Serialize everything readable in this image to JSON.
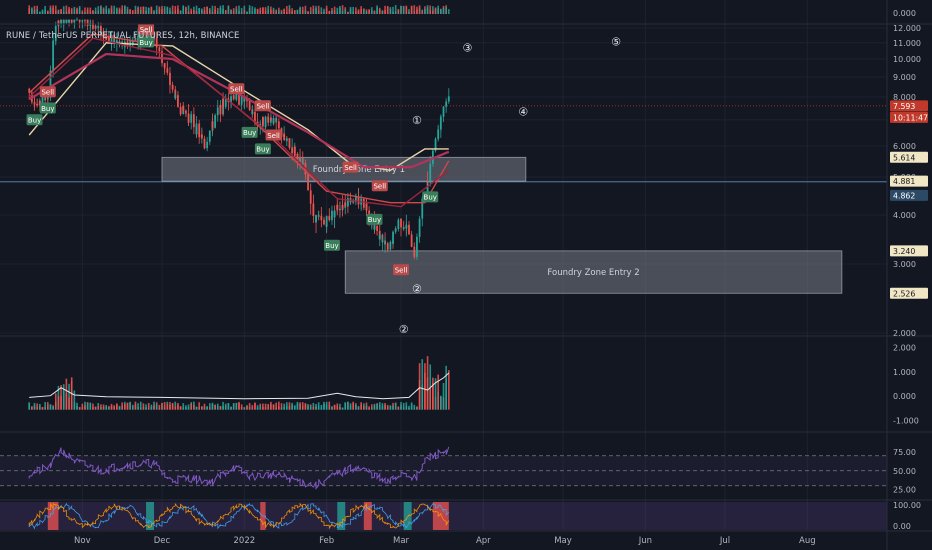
{
  "title": "RUNE / TetherUS PERPETUAL FUTURES, 12h, BINANCE",
  "chart_data": [
    {
      "type": "candlestick",
      "title": "RUNE / TetherUS PERPETUAL FUTURES, 12h, BINANCE",
      "ylim": [
        2.0,
        12.0
      ],
      "y_ticks": [
        "12.000",
        "11.000",
        "10.000",
        "9.000",
        "8.000",
        "7.000",
        "6.000",
        "5.000",
        "4.000",
        "3.000",
        "2.000"
      ],
      "x_ticks": [
        "Nov",
        "Dec",
        "2022",
        "Feb",
        "Mar",
        "Apr",
        "May",
        "Jun",
        "Jul",
        "Aug"
      ],
      "price_path": [
        [
          "2021-10-12",
          8.4
        ],
        [
          "2021-10-16",
          7.6
        ],
        [
          "2021-10-20",
          8.1
        ],
        [
          "2021-10-23",
          12.2
        ],
        [
          "2021-10-28",
          12.8
        ],
        [
          "2021-11-05",
          12.4
        ],
        [
          "2021-11-12",
          11.2
        ],
        [
          "2021-11-18",
          10.8
        ],
        [
          "2021-11-25",
          11.6
        ],
        [
          "2021-11-29",
          11.2
        ],
        [
          "2021-12-04",
          9.0
        ],
        [
          "2021-12-08",
          7.6
        ],
        [
          "2021-12-13",
          7.0
        ],
        [
          "2021-12-18",
          6.0
        ],
        [
          "2021-12-23",
          7.4
        ],
        [
          "2021-12-28",
          8.1
        ],
        [
          "2022-01-02",
          7.8
        ],
        [
          "2022-01-07",
          6.8
        ],
        [
          "2022-01-12",
          7.1
        ],
        [
          "2022-01-17",
          6.2
        ],
        [
          "2022-01-20",
          5.9
        ],
        [
          "2022-01-24",
          5.3
        ],
        [
          "2022-01-28",
          4.0
        ],
        [
          "2022-02-01",
          3.8
        ],
        [
          "2022-02-06",
          4.2
        ],
        [
          "2022-02-11",
          4.4
        ],
        [
          "2022-02-16",
          4.3
        ],
        [
          "2022-02-21",
          3.6
        ],
        [
          "2022-02-25",
          3.2
        ],
        [
          "2022-03-01",
          3.9
        ],
        [
          "2022-03-04",
          3.7
        ],
        [
          "2022-03-07",
          3.2
        ],
        [
          "2022-03-10",
          4.3
        ],
        [
          "2022-03-12",
          4.9
        ],
        [
          "2022-03-14",
          5.9
        ],
        [
          "2022-03-16",
          6.8
        ],
        [
          "2022-03-18",
          7.6
        ],
        [
          "2022-03-19",
          7.9
        ]
      ],
      "moving_averages": [
        {
          "color": "#e8d6a8",
          "values": [
            [
              "2021-10-12",
              6.4
            ],
            [
              "2021-11-10",
              11.0
            ],
            [
              "2021-12-05",
              10.8
            ],
            [
              "2022-01-01",
              8.3
            ],
            [
              "2022-01-25",
              6.6
            ],
            [
              "2022-02-10",
              5.4
            ],
            [
              "2022-02-25",
              5.2
            ],
            [
              "2022-03-10",
              5.9
            ],
            [
              "2022-03-19",
              5.9
            ]
          ]
        },
        {
          "color": "#b0345a",
          "values": [
            [
              "2021-10-12",
              7.9
            ],
            [
              "2021-11-10",
              10.3
            ],
            [
              "2021-12-05",
              10.0
            ],
            [
              "2022-01-01",
              8.0
            ],
            [
              "2022-01-25",
              6.5
            ],
            [
              "2022-02-15",
              5.3
            ],
            [
              "2022-03-05",
              5.3
            ],
            [
              "2022-03-19",
              5.8
            ]
          ]
        },
        {
          "color": "#d04848",
          "values": [
            [
              "2021-10-12",
              8.2
            ],
            [
              "2021-11-05",
              11.6
            ],
            [
              "2021-12-01",
              10.8
            ],
            [
              "2022-01-05",
              6.9
            ],
            [
              "2022-02-01",
              4.6
            ],
            [
              "2022-02-25",
              4.3
            ],
            [
              "2022-03-10",
              4.3
            ],
            [
              "2022-03-19",
              5.5
            ]
          ]
        },
        {
          "color": "#9c2540",
          "values": [
            [
              "2021-10-12",
              8.0
            ],
            [
              "2021-11-05",
              11.3
            ],
            [
              "2021-12-05",
              10.2
            ],
            [
              "2022-01-10",
              6.5
            ],
            [
              "2022-02-05",
              4.4
            ],
            [
              "2022-03-01",
              4.2
            ],
            [
              "2022-03-19",
              5.2
            ]
          ]
        }
      ],
      "signals": [
        {
          "label": "Sell",
          "date": "2021-10-19",
          "price": 8.25,
          "kind": "sell"
        },
        {
          "label": "Buy",
          "date": "2021-10-19",
          "price": 7.5,
          "kind": "buy"
        },
        {
          "label": "Buy",
          "date": "2021-10-14",
          "price": 7.0,
          "kind": "buy"
        },
        {
          "label": "Sell",
          "date": "2021-11-25",
          "price": 11.9,
          "kind": "sell"
        },
        {
          "label": "Buy",
          "date": "2021-11-25",
          "price": 11.05,
          "kind": "buy"
        },
        {
          "label": "Sell",
          "date": "2021-12-29",
          "price": 8.4,
          "kind": "sell"
        },
        {
          "label": "Sell",
          "date": "2022-01-08",
          "price": 7.6,
          "kind": "sell"
        },
        {
          "label": "Buy",
          "date": "2022-01-03",
          "price": 6.5,
          "kind": "buy"
        },
        {
          "label": "Sell",
          "date": "2022-01-12",
          "price": 6.4,
          "kind": "sell"
        },
        {
          "label": "Buy",
          "date": "2022-01-08",
          "price": 5.9,
          "kind": "buy"
        },
        {
          "label": "Sell",
          "date": "2022-02-10",
          "price": 5.3,
          "kind": "sell"
        },
        {
          "label": "Sell",
          "date": "2022-02-21",
          "price": 4.75,
          "kind": "sell"
        },
        {
          "label": "Buy",
          "date": "2022-02-19",
          "price": 3.9,
          "kind": "buy"
        },
        {
          "label": "Buy",
          "date": "2022-02-03",
          "price": 3.35,
          "kind": "buy"
        },
        {
          "label": "Sell",
          "date": "2022-03-01",
          "price": 2.9,
          "kind": "sell"
        },
        {
          "label": "Buy",
          "date": "2022-03-12",
          "price": 4.45,
          "kind": "buy"
        }
      ],
      "zones": [
        {
          "label": "Foundry Zone Entry 1",
          "from": "2021-12-01",
          "to": "2022-04-17",
          "top": 5.614,
          "bottom": 4.881
        },
        {
          "label": "Foundry Zone Entry 2",
          "from": "2022-02-08",
          "to": "2022-08-14",
          "top": 3.24,
          "bottom": 2.526
        }
      ],
      "wave_labels": [
        {
          "label": "①",
          "date": "2022-03-07",
          "price": 7.0
        },
        {
          "label": "②",
          "date": "2022-03-02",
          "price": 2.05
        },
        {
          "label": "②",
          "date": "2022-03-07",
          "price": 2.6
        },
        {
          "label": "③",
          "date": "2022-03-26",
          "price": 10.7
        },
        {
          "label": "④",
          "date": "2022-04-16",
          "price": 7.35
        },
        {
          "label": "⑤",
          "date": "2022-05-21",
          "price": 11.1
        }
      ],
      "price_badges": [
        {
          "text": "7.593",
          "value": 7.593,
          "bg": "#c0392b",
          "fg": "#ffffff"
        },
        {
          "text": "10:11:47",
          "value": 7.1,
          "bg": "#c0392b",
          "fg": "#ffffff"
        },
        {
          "text": "5.614",
          "value": 5.614,
          "bg": "#f1e7c4",
          "fg": "#131722"
        },
        {
          "text": "4.881",
          "value": 4.881,
          "bg": "#f1e7c4",
          "fg": "#131722"
        },
        {
          "text": "4.862",
          "value": 4.49,
          "bg": "#2c4a66",
          "fg": "#ffffff"
        },
        {
          "text": "3.240",
          "value": 3.24,
          "bg": "#f1e7c4",
          "fg": "#131722"
        },
        {
          "text": "2.526",
          "value": 2.526,
          "bg": "#f1e7c4",
          "fg": "#131722"
        }
      ],
      "last_price": 7.593,
      "horizontal_line": 4.862
    },
    {
      "type": "bar",
      "title": "",
      "top_axis_label": "0.000",
      "y_ticks": [
        "2.000",
        "1.000",
        "0.000",
        "-1.000"
      ],
      "ylim": [
        -1.3,
        2.3
      ],
      "oscillator": [
        [
          "2021-10-12",
          -0.05
        ],
        [
          "2021-10-20",
          0.02
        ],
        [
          "2021-10-24",
          0.35
        ],
        [
          "2021-10-29",
          0.05
        ],
        [
          "2021-11-10",
          -0.02
        ],
        [
          "2021-12-01",
          -0.05
        ],
        [
          "2022-01-01",
          -0.1
        ],
        [
          "2022-01-25",
          -0.08
        ],
        [
          "2022-02-05",
          0.12
        ],
        [
          "2022-02-12",
          -0.02
        ],
        [
          "2022-02-22",
          -0.1
        ],
        [
          "2022-03-04",
          -0.05
        ],
        [
          "2022-03-08",
          0.35
        ],
        [
          "2022-03-11",
          0.25
        ],
        [
          "2022-03-14",
          0.55
        ],
        [
          "2022-03-17",
          0.75
        ],
        [
          "2022-03-19",
          0.95
        ]
      ]
    },
    {
      "type": "line",
      "title": "",
      "y_ticks": [
        "75.00",
        "50.00",
        "25.00"
      ],
      "ylim": [
        15,
        95
      ],
      "bands": [
        70,
        50,
        30
      ],
      "values": [
        [
          "2021-10-12",
          45
        ],
        [
          "2021-10-20",
          55
        ],
        [
          "2021-10-24",
          78
        ],
        [
          "2021-10-30",
          62
        ],
        [
          "2021-11-08",
          50
        ],
        [
          "2021-11-18",
          58
        ],
        [
          "2021-11-28",
          60
        ],
        [
          "2021-12-04",
          38
        ],
        [
          "2021-12-12",
          40
        ],
        [
          "2021-12-20",
          35
        ],
        [
          "2021-12-28",
          55
        ],
        [
          "2022-01-04",
          42
        ],
        [
          "2022-01-12",
          45
        ],
        [
          "2022-01-20",
          38
        ],
        [
          "2022-01-28",
          30
        ],
        [
          "2022-02-05",
          45
        ],
        [
          "2022-02-12",
          55
        ],
        [
          "2022-02-18",
          47
        ],
        [
          "2022-02-24",
          33
        ],
        [
          "2022-03-02",
          48
        ],
        [
          "2022-03-07",
          40
        ],
        [
          "2022-03-11",
          66
        ],
        [
          "2022-03-15",
          72
        ],
        [
          "2022-03-19",
          78
        ]
      ]
    },
    {
      "type": "area",
      "title": "",
      "y_ticks": [
        "100.00",
        "0.00"
      ],
      "ylim": [
        0,
        100
      ]
    }
  ]
}
